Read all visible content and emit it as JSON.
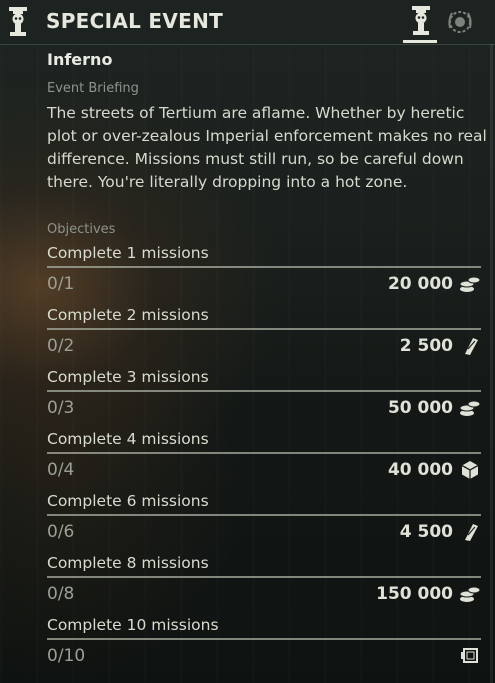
{
  "header": {
    "title": "SPECIAL EVENT",
    "emblem_icon": "skull-column-icon",
    "tabs": [
      {
        "icon": "skull-column-icon",
        "active": true
      },
      {
        "icon": "laurel-wreath-icon",
        "active": false
      }
    ]
  },
  "event": {
    "name": "Inferno",
    "briefing_label": "Event Briefing",
    "briefing_text": "The streets of Tertium are aflame. Whether by heretic plot or over-zealous Imperial enforcement makes no real difference. Missions must still run, so be careful down there. You're literally dropping into a hot zone.",
    "objectives_label": "Objectives"
  },
  "objectives": [
    {
      "title": "Complete 1 missions",
      "progress": "0/1",
      "reward": "20 000",
      "reward_icon": "coins-icon"
    },
    {
      "title": "Complete 2 missions",
      "progress": "0/2",
      "reward": "2 500",
      "reward_icon": "plasteel-icon"
    },
    {
      "title": "Complete 3 missions",
      "progress": "0/3",
      "reward": "50 000",
      "reward_icon": "coins-icon"
    },
    {
      "title": "Complete 4 missions",
      "progress": "0/4",
      "reward": "40 000",
      "reward_icon": "diamantine-icon"
    },
    {
      "title": "Complete 6 missions",
      "progress": "0/6",
      "reward": "4 500",
      "reward_icon": "plasteel-icon"
    },
    {
      "title": "Complete 8 missions",
      "progress": "0/8",
      "reward": "150 000",
      "reward_icon": "coins-icon"
    },
    {
      "title": "Complete 10 missions",
      "progress": "0/10",
      "reward": "",
      "reward_icon": "cosmetic-frame-icon"
    }
  ],
  "colors": {
    "text": "#d8dccf",
    "muted": "#8d948c",
    "header_bg": "#1d2320",
    "rule": "#a7ac9f"
  }
}
